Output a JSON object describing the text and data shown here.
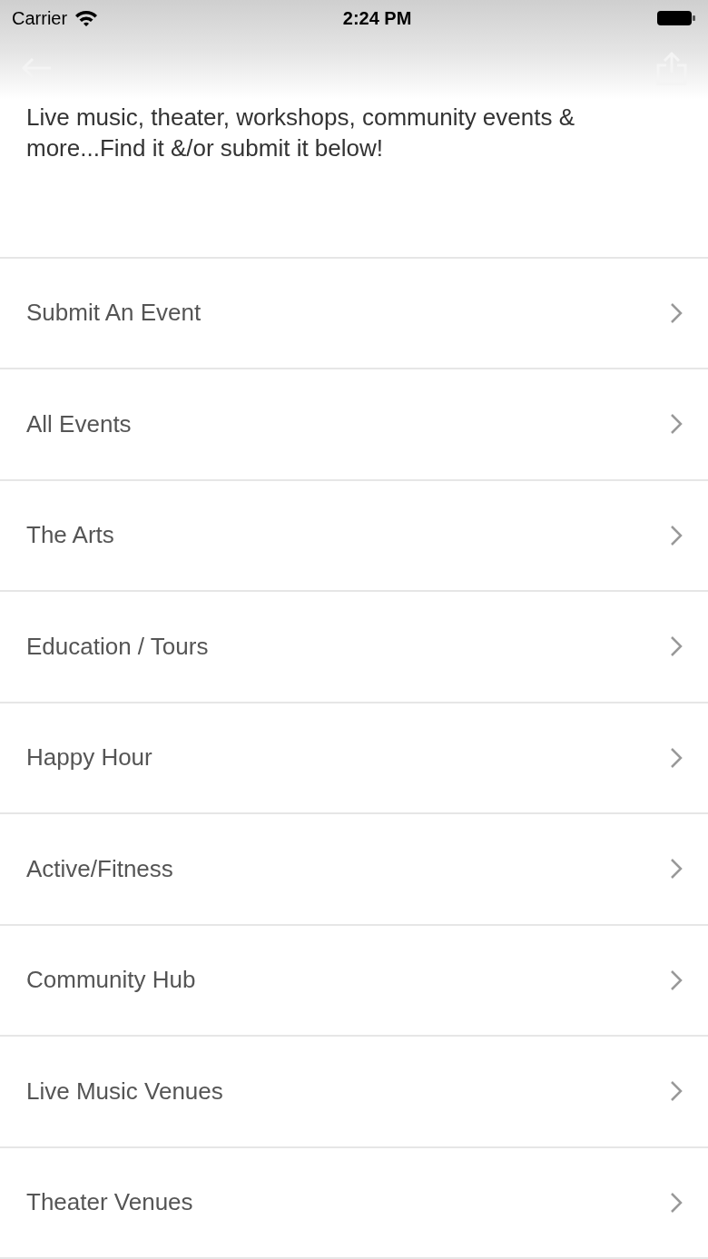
{
  "status_bar": {
    "carrier": "Carrier",
    "time": "2:24 PM"
  },
  "intro": "Live music, theater, workshops, community events & more...Find it &/or submit it below!",
  "menu": [
    {
      "label": "Submit An Event"
    },
    {
      "label": "All Events"
    },
    {
      "label": "The Arts"
    },
    {
      "label": "Education / Tours"
    },
    {
      "label": "Happy Hour"
    },
    {
      "label": "Active/Fitness"
    },
    {
      "label": "Community Hub"
    },
    {
      "label": "Live Music Venues"
    },
    {
      "label": "Theater Venues"
    }
  ]
}
